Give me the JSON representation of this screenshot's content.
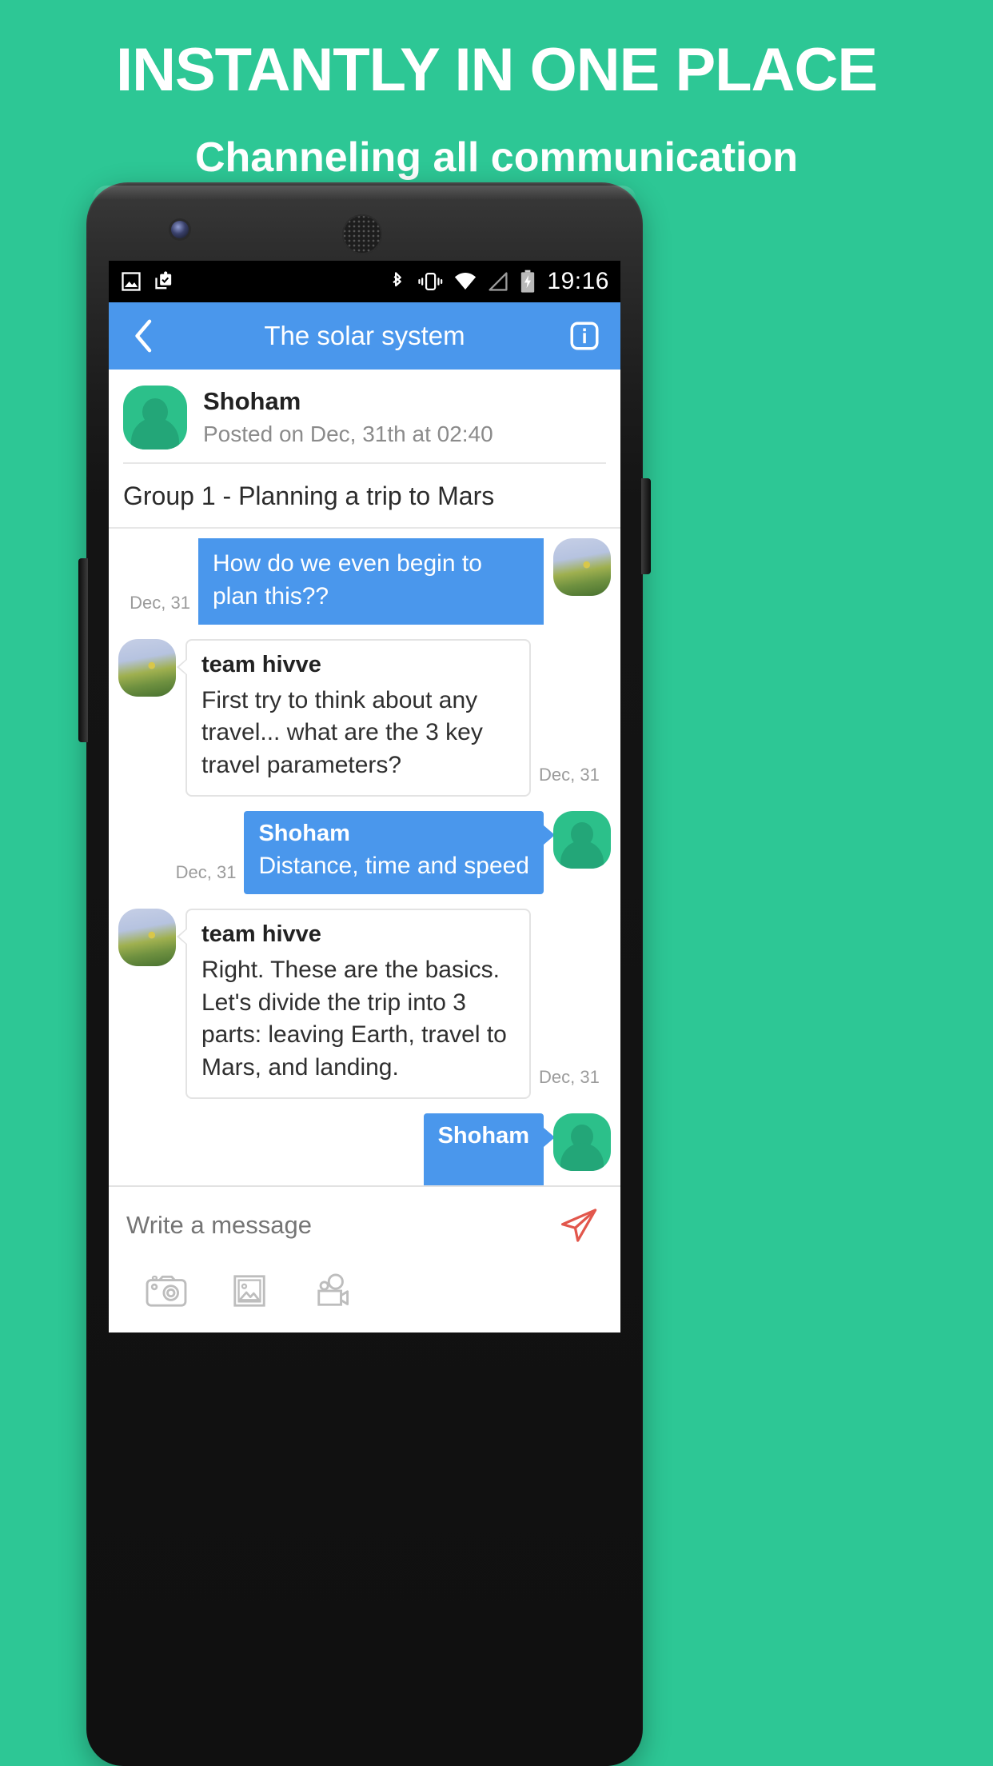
{
  "marketing": {
    "headline": "INSTANTLY IN ONE PLACE",
    "subheadline": "Channeling all communication",
    "background_color": "#2dc795"
  },
  "statusbar": {
    "time": "19:16",
    "left_icons": [
      "image-icon",
      "clipboard-check-icon"
    ],
    "right_icons": [
      "bluetooth-icon",
      "vibrate-icon",
      "wifi-icon",
      "signal-icon",
      "battery-charging-icon"
    ]
  },
  "appbar": {
    "title": "The solar system",
    "back_icon": "chevron-left-icon",
    "info_icon": "info-icon",
    "color": "#4a97ec"
  },
  "post": {
    "author": "Shoham",
    "posted": "Posted on Dec, 31th at 02:40",
    "group_title": "Group 1 - Planning a trip to Mars"
  },
  "messages": [
    {
      "side": "out",
      "sender": "",
      "text": "How do we even begin to plan this??",
      "stamp": "Dec, 31",
      "avatar": "photo-avatar",
      "show_sender": false
    },
    {
      "side": "in",
      "sender": "team hivve",
      "text": "First try to think about any travel... what are the 3 key travel parameters?",
      "stamp": "Dec, 31",
      "avatar": "plant-photo-avatar",
      "show_sender": true
    },
    {
      "side": "out",
      "sender": "Shoham",
      "text": "Distance, time and speed",
      "stamp": "Dec, 31",
      "avatar": "green-person-avatar",
      "show_sender": true
    },
    {
      "side": "in",
      "sender": "team hivve",
      "text": "Right. These are the basics. Let's divide the trip into 3 parts: leaving Earth, travel to Mars, and landing.",
      "stamp": "Dec, 31",
      "avatar": "plant-photo-avatar",
      "show_sender": true
    },
    {
      "side": "out",
      "sender": "Shoham",
      "text": "",
      "stamp": "",
      "avatar": "green-person-avatar",
      "show_sender": true
    }
  ],
  "composer": {
    "placeholder": "Write a message",
    "send_icon": "send-paper-plane-icon",
    "send_color": "#e2574c",
    "attachments": [
      "camera-icon",
      "gallery-icon",
      "video-camera-icon"
    ]
  }
}
